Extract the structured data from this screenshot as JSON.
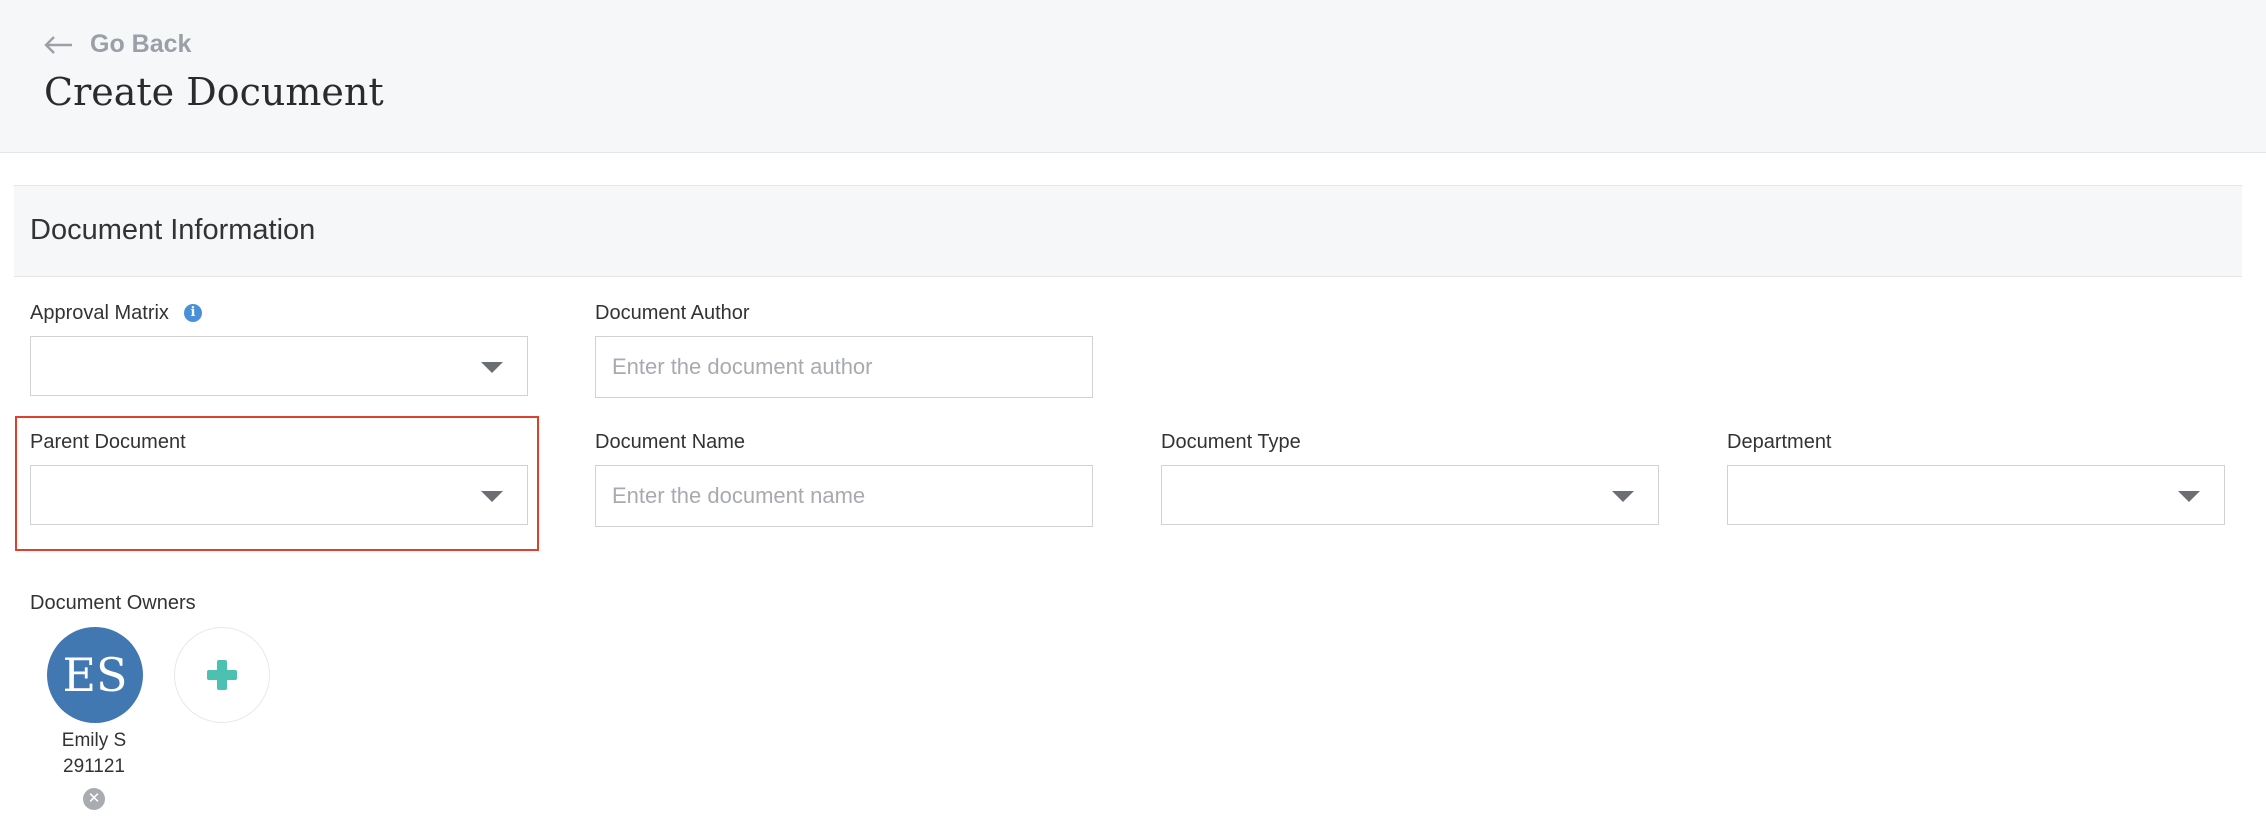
{
  "header": {
    "back_label": "Go Back",
    "title": "Create Document"
  },
  "section": {
    "title": "Document Information"
  },
  "fields": {
    "approval_matrix": {
      "label": "Approval Matrix",
      "value": ""
    },
    "document_author": {
      "label": "Document Author",
      "placeholder": "Enter the document author",
      "value": ""
    },
    "parent_document": {
      "label": "Parent Document",
      "value": ""
    },
    "document_name": {
      "label": "Document Name",
      "placeholder": "Enter the document name",
      "value": ""
    },
    "document_type": {
      "label": "Document Type",
      "value": ""
    },
    "department": {
      "label": "Department",
      "value": ""
    }
  },
  "owners": {
    "label": "Document Owners",
    "items": [
      {
        "initials": "ES",
        "name": "Emily S",
        "id": "291121",
        "avatar_color": "#4178b2"
      }
    ]
  },
  "icons": {
    "back": "arrow-left-icon",
    "info": "info-icon",
    "caret": "chevron-down-icon",
    "remove": "close-circle-icon",
    "add": "plus-icon"
  },
  "colors": {
    "accent_blue": "#4a90d9",
    "add_green": "#4cc0b1",
    "highlight_red": "#e0402a"
  }
}
